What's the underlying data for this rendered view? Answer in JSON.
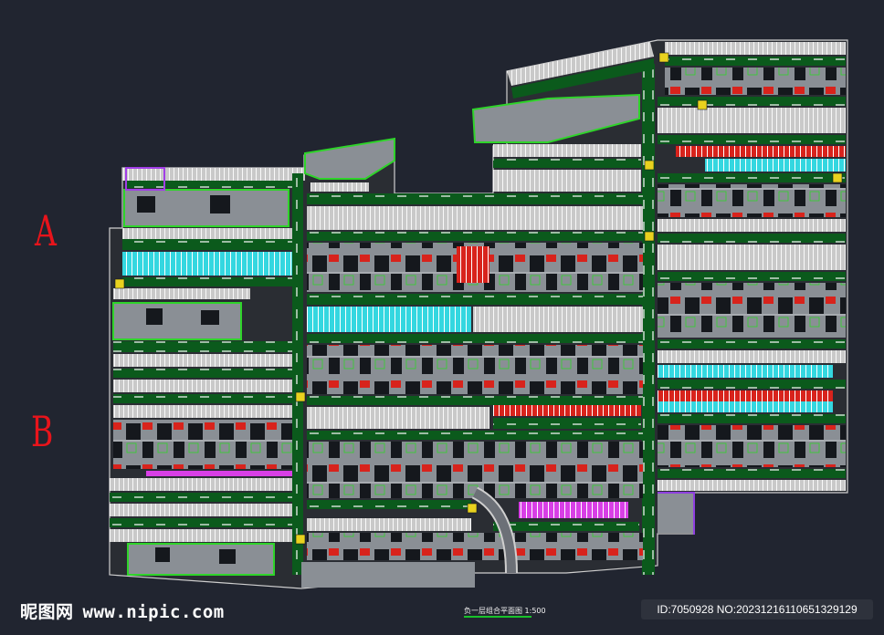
{
  "zones": {
    "a": "A",
    "b": "B"
  },
  "plan_title": "负一层组合平面图",
  "plan_scale": "1:500",
  "watermark": {
    "brand": "昵图网",
    "url": "www.nipic.com"
  },
  "id_text": "ID:7050928 NO:20231216110651329129",
  "colors": {
    "background": "#212530",
    "drive_lane": "#0b5a1c",
    "parking_band": "#c9c9c9",
    "parking_line": "#ffffff",
    "curb_yellow": "#e9d21e",
    "service_room": "#8a8f95",
    "core_block": "#15181d",
    "cyan_stalls": "#34d7e0",
    "red_stalls": "#d8231c",
    "magenta_stalls": "#d83fe6",
    "green_outline": "#2fd42a",
    "zone_label": "#e8141b"
  }
}
